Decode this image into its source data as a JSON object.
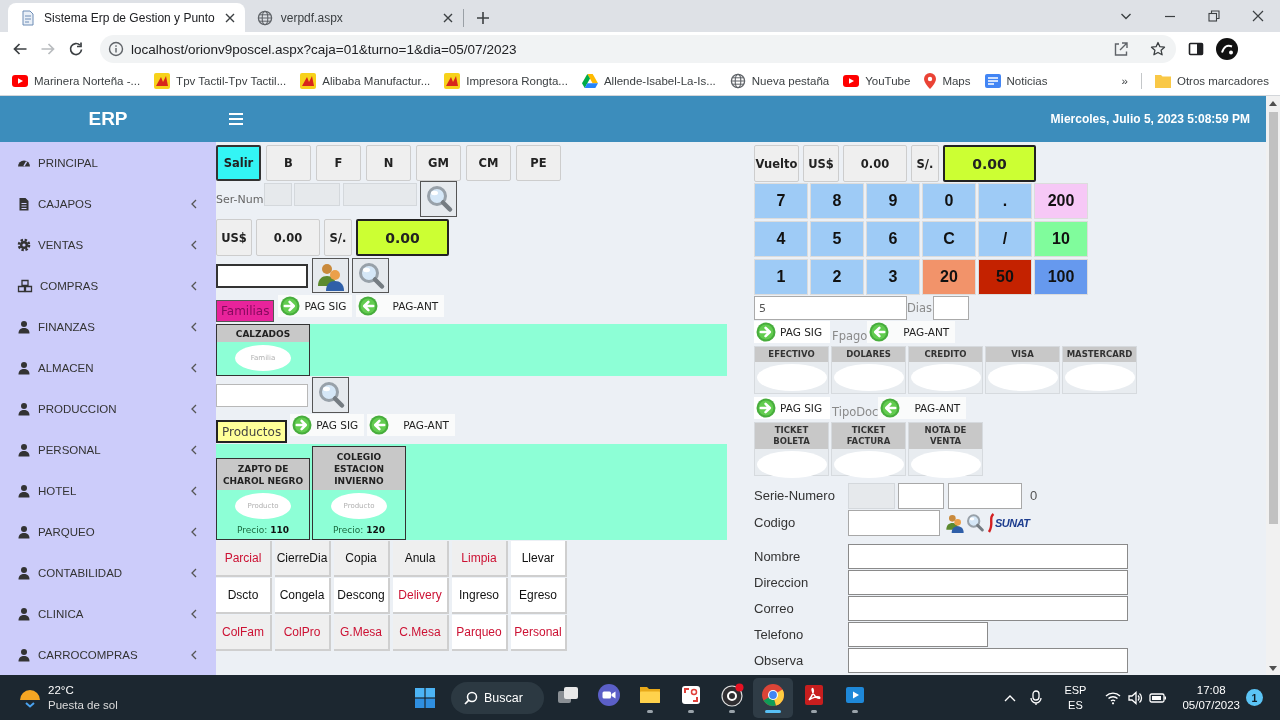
{
  "browser": {
    "tabs": [
      {
        "title": "Sistema Erp de Gestion y Punto",
        "kind": "document",
        "selected": true
      },
      {
        "title": "verpdf.aspx",
        "kind": "globe",
        "selected": false
      }
    ],
    "address": "localhost/orionv9poscel.aspx?caja=01&turno=1&dia=05/07/2023",
    "bookmarks": [
      {
        "label": "Marinera Norteña -...",
        "kind": "youtube"
      },
      {
        "label": "Tpv Tactil-Tpv Tactil...",
        "kind": "flame"
      },
      {
        "label": "Alibaba Manufactur...",
        "kind": "flame"
      },
      {
        "label": "Impresora Rongta...",
        "kind": "flame"
      },
      {
        "label": "Allende-Isabel-La-Is...",
        "kind": "drive"
      },
      {
        "label": "Nueva pestaña",
        "kind": "globe"
      },
      {
        "label": "YouTube",
        "kind": "youtube"
      },
      {
        "label": "Maps",
        "kind": "pin"
      },
      {
        "label": "Noticias",
        "kind": "news"
      }
    ],
    "more": "»",
    "other_bookmarks": "Otros marcadores"
  },
  "header": {
    "brand": "ERP",
    "datetime": "Miercoles, Julio 5, 2023 5:08:59 PM"
  },
  "sidebar": {
    "items": [
      {
        "label": "PRINCIPAL",
        "kind": "dashboard",
        "submenu": false
      },
      {
        "label": "CAJAPOS",
        "kind": "document",
        "submenu": true
      },
      {
        "label": "VENTAS",
        "kind": "gear",
        "submenu": true
      },
      {
        "label": "COMPRAS",
        "kind": "cubes",
        "submenu": true
      },
      {
        "label": "FINANZAS",
        "kind": "user",
        "submenu": true
      },
      {
        "label": "ALMACEN",
        "kind": "user",
        "submenu": true
      },
      {
        "label": "PRODUCCION",
        "kind": "user",
        "submenu": true
      },
      {
        "label": "PERSONAL",
        "kind": "user",
        "submenu": true
      },
      {
        "label": "HOTEL",
        "kind": "user",
        "submenu": true
      },
      {
        "label": "PARQUEO",
        "kind": "user",
        "submenu": true
      },
      {
        "label": "CONTABILIDAD",
        "kind": "user",
        "submenu": true
      },
      {
        "label": "CLINICA",
        "kind": "user",
        "submenu": true
      },
      {
        "label": "CARROCOMPRAS",
        "kind": "user",
        "submenu": true
      }
    ]
  },
  "order": {
    "actions": [
      {
        "label": "Salir",
        "kind": "accent"
      },
      {
        "label": "B",
        "kind": "plain"
      },
      {
        "label": "F",
        "kind": "plain"
      },
      {
        "label": "N",
        "kind": "plain"
      },
      {
        "label": "GM",
        "kind": "plain"
      },
      {
        "label": "CM",
        "kind": "plain"
      },
      {
        "label": "PE",
        "kind": "plain"
      }
    ],
    "series_label": "Ser-Num",
    "series_fields": [
      {
        "disabled": true
      },
      {
        "disabled": true
      },
      {
        "disabled": true
      }
    ],
    "currency_code": "US$",
    "amount": "0.00",
    "local_currency": "S/.",
    "total": "0.00"
  },
  "families": {
    "label": "Familias",
    "next": "PAG SIG",
    "prev": "PAG-ANT",
    "items": [
      {
        "name": "CALZADOS",
        "image_label": "Familia"
      }
    ]
  },
  "products": {
    "label": "Productos",
    "next": "PAG SIG",
    "prev": "PAG-ANT",
    "items": [
      {
        "name": "ZAPTO DE CHAROL NEGRO",
        "image_label": "Producto",
        "price": "Precio: **110**"
      },
      {
        "name": "COLEGIO ESTACION INVIERNO",
        "image_label": "Producto",
        "price": "Precio: **120**"
      }
    ]
  },
  "pos_buttons": [
    {
      "label": "Parcial",
      "kind": "shaded",
      "color": "#cc1133"
    },
    {
      "label": "CierreDia",
      "kind": "shaded",
      "color": "#111111"
    },
    {
      "label": "Copia",
      "kind": "shaded",
      "color": "#111111"
    },
    {
      "label": "Anula",
      "kind": "shaded",
      "color": "#111111"
    },
    {
      "label": "Limpia",
      "kind": "shaded",
      "color": "#cc1133"
    },
    {
      "label": "Llevar",
      "kind": "plain",
      "color": "#111111"
    },
    {
      "label": "Dscto",
      "kind": "plain",
      "color": "#111111"
    },
    {
      "label": "Congela",
      "kind": "plain",
      "color": "#111111"
    },
    {
      "label": "Descong",
      "kind": "plain",
      "color": "#111111"
    },
    {
      "label": "Delivery",
      "kind": "plain",
      "color": "#cc1133"
    },
    {
      "label": "Ingreso",
      "kind": "plain",
      "color": "#111111"
    },
    {
      "label": "Egreso",
      "kind": "plain",
      "color": "#111111"
    },
    {
      "label": "ColFam",
      "kind": "shaded",
      "color": "#cc1133"
    },
    {
      "label": "ColPro",
      "kind": "shaded",
      "color": "#cc1133"
    },
    {
      "label": "G.Mesa",
      "kind": "shaded",
      "color": "#cc1133"
    },
    {
      "label": "C.Mesa",
      "kind": "shaded",
      "color": "#cc1133"
    },
    {
      "label": "Parqueo",
      "kind": "plain",
      "color": "#cc1133"
    },
    {
      "label": "Personal",
      "kind": "plain",
      "color": "#cc1133"
    }
  ],
  "change": {
    "label": "Vuelto",
    "currency_code": "US$",
    "amount": "0.00",
    "local_currency": "S/.",
    "total": "0.00"
  },
  "keypad": [
    {
      "label": "7",
      "color": "#9ecbf6"
    },
    {
      "label": "8",
      "color": "#9ecbf6"
    },
    {
      "label": "9",
      "color": "#9ecbf6"
    },
    {
      "label": "0",
      "color": "#9ecbf6"
    },
    {
      "label": ".",
      "color": "#9ecbf6"
    },
    {
      "label": "200",
      "color": "#f6c8f6"
    },
    {
      "label": "4",
      "color": "#9ecbf6"
    },
    {
      "label": "5",
      "color": "#9ecbf6"
    },
    {
      "label": "6",
      "color": "#9ecbf6"
    },
    {
      "label": "C",
      "color": "#9ecbf6"
    },
    {
      "label": "/",
      "color": "#9ecbf6"
    },
    {
      "label": "10",
      "color": "#80fc9c"
    },
    {
      "label": "1",
      "color": "#9ecbf6"
    },
    {
      "label": "2",
      "color": "#9ecbf6"
    },
    {
      "label": "3",
      "color": "#9ecbf6"
    },
    {
      "label": "20",
      "color": "#f2936a"
    },
    {
      "label": "50",
      "color": "#c42200"
    },
    {
      "label": "100",
      "color": "#6699ee"
    }
  ],
  "quantity": {
    "value": "5",
    "days_label": "Dias"
  },
  "payment": {
    "label": "Fpago",
    "next": "PAG SIG",
    "prev": "PAG-ANT",
    "methods": [
      {
        "name": "EFECTIVO"
      },
      {
        "name": "DOLARES"
      },
      {
        "name": "CREDITO"
      },
      {
        "name": "VISA"
      },
      {
        "name": "MASTERCARD"
      }
    ]
  },
  "document_type": {
    "label": "TipoDoc",
    "next": "PAG SIG",
    "prev": "PAG-ANT",
    "types": [
      {
        "name": "TICKET BOLETA"
      },
      {
        "name": "TICKET FACTURA"
      },
      {
        "name": "NOTA DE VENTA"
      }
    ]
  },
  "customer": {
    "series_label": "Serie-Numero",
    "series_fields": [
      {
        "disabled": true
      },
      {
        "disabled": false
      },
      {
        "disabled": false
      }
    ],
    "series_count": "0",
    "code_label": "Codigo",
    "logo_text": "SUNAT",
    "fields": [
      {
        "label": "Nombre",
        "kind": "wide"
      },
      {
        "label": "Direccion",
        "kind": "wide"
      },
      {
        "label": "Correo",
        "kind": "wide"
      },
      {
        "label": "Telefono",
        "kind": "short"
      },
      {
        "label": "Observa",
        "kind": "wide"
      }
    ]
  },
  "taskbar": {
    "temperature": "22°C",
    "condition": "Puesta de sol",
    "search": "Buscar",
    "apps": [
      {
        "kind": "taskview",
        "running": false,
        "selected": false
      },
      {
        "kind": "video",
        "running": false,
        "selected": false
      },
      {
        "kind": "folder",
        "running": true,
        "selected": false
      },
      {
        "kind": "capture",
        "running": true,
        "selected": false
      },
      {
        "kind": "recorder",
        "running": true,
        "selected": false
      },
      {
        "kind": "browser",
        "running": true,
        "selected": true
      },
      {
        "kind": "document",
        "running": true,
        "selected": false
      },
      {
        "kind": "media",
        "running": true,
        "selected": false
      }
    ],
    "language": "ESP",
    "layout": "ES",
    "time": "17:08",
    "date": "05/07/2023",
    "notifications": "1"
  }
}
